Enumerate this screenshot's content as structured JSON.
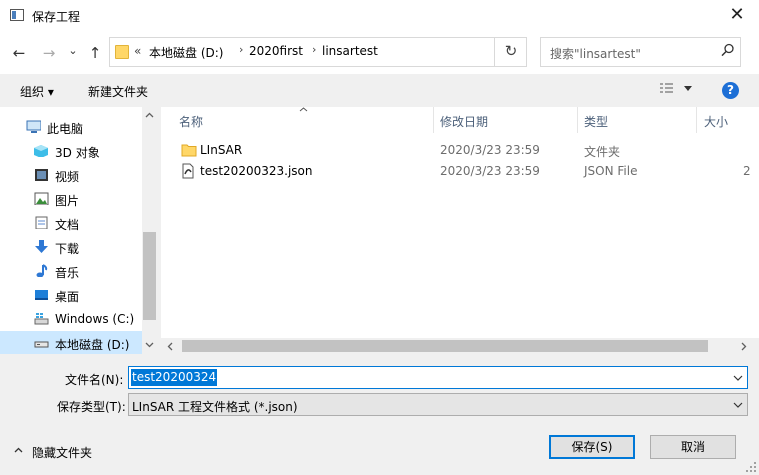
{
  "window": {
    "title": "保存工程",
    "close": "✕"
  },
  "nav": {
    "back": "←",
    "forward": "→",
    "dropdown": "⌄",
    "up": "↑",
    "breadcrumb_prefix": "«",
    "breadcrumb": [
      "本地磁盘 (D:)",
      "2020first",
      "linsartest"
    ],
    "separator": "›",
    "refresh": "↻",
    "search_placeholder": "搜索\"linsartest\""
  },
  "toolbar": {
    "organize": "组织 ▾",
    "new_folder": "新建文件夹",
    "help": "?"
  },
  "sidebar": {
    "items": [
      {
        "label": "此电脑",
        "icon": "computer-icon"
      },
      {
        "label": "3D 对象",
        "icon": "3d-objects-icon"
      },
      {
        "label": "视频",
        "icon": "video-icon"
      },
      {
        "label": "图片",
        "icon": "pictures-icon"
      },
      {
        "label": "文档",
        "icon": "documents-icon"
      },
      {
        "label": "下载",
        "icon": "download-icon"
      },
      {
        "label": "音乐",
        "icon": "music-icon"
      },
      {
        "label": "桌面",
        "icon": "desktop-icon"
      },
      {
        "label": "Windows (C:)",
        "icon": "drive-c-icon"
      },
      {
        "label": "本地磁盘 (D:)",
        "icon": "drive-d-icon",
        "selected": true
      }
    ]
  },
  "file_list": {
    "columns": [
      "名称",
      "修改日期",
      "类型",
      "大小"
    ],
    "rows": [
      {
        "name": "LInSAR",
        "date": "2020/3/23 23:59",
        "type": "文件夹",
        "size": "",
        "icon": "folder-icon"
      },
      {
        "name": "test20200323.json",
        "date": "2020/3/23 23:59",
        "type": "JSON File",
        "size": "2",
        "icon": "json-file-icon"
      }
    ]
  },
  "form": {
    "filename_label": "文件名(N):",
    "filename_value": "test20200324",
    "filetype_label": "保存类型(T):",
    "filetype_value": "LInSAR 工程文件格式 (*.json)"
  },
  "footer": {
    "hide_folders": "隐藏文件夹",
    "save": "保存(S)",
    "cancel": "取消"
  },
  "colors": {
    "accent": "#0078d7",
    "folder": "#ffd768",
    "selected_bg": "#cce8ff"
  }
}
